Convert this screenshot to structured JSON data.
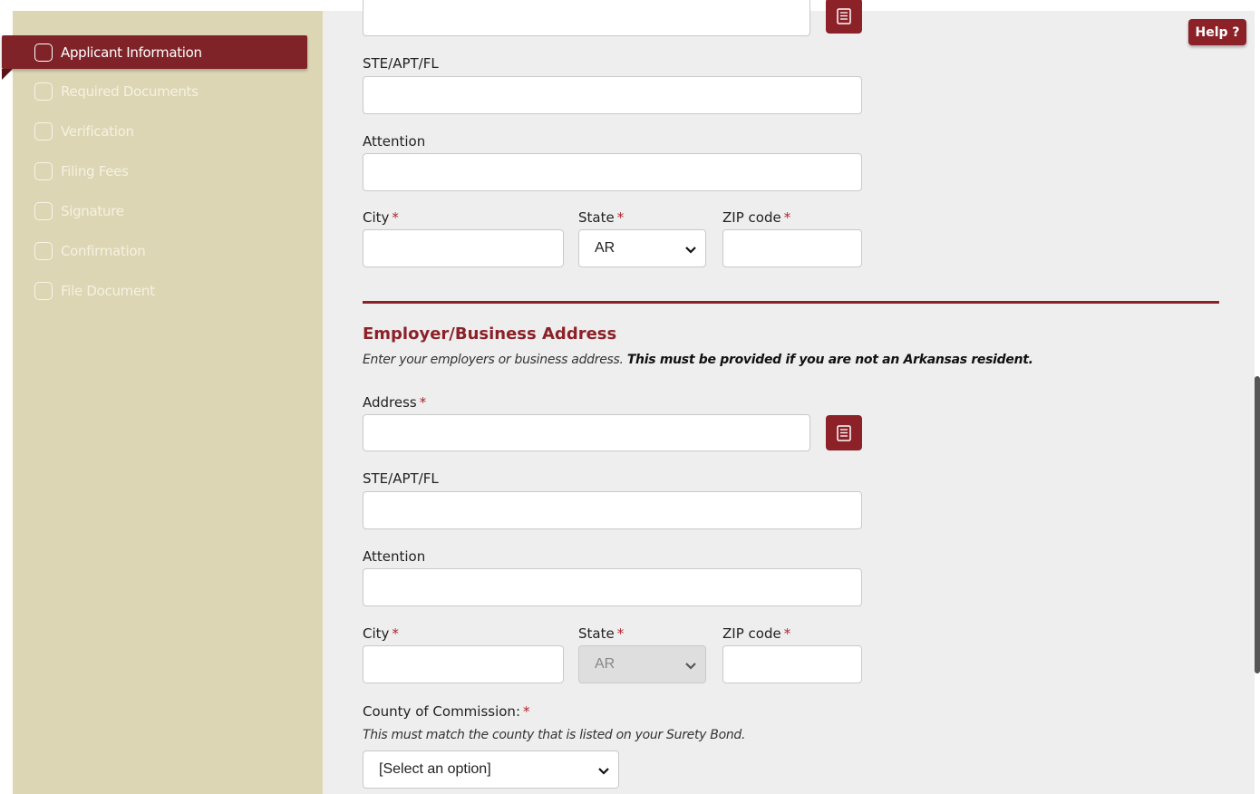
{
  "help_button": "Help ?",
  "steps": [
    {
      "label": "Applicant Information",
      "active": true
    },
    {
      "label": "Required Documents",
      "active": false
    },
    {
      "label": "Verification",
      "active": false
    },
    {
      "label": "Filing Fees",
      "active": false
    },
    {
      "label": "Signature",
      "active": false
    },
    {
      "label": "Confirmation",
      "active": false
    },
    {
      "label": "File Document",
      "active": false
    }
  ],
  "home_address": {
    "suite_label": "STE/APT/FL",
    "attention_label": "Attention",
    "city_label": "City",
    "state_label": "State",
    "state_value": "AR",
    "zip_label": "ZIP code"
  },
  "employer_address": {
    "title": "Employer/Business Address",
    "hint_text": "Enter your employers or business address.",
    "hint_bold": "This must be provided if you are not an Arkansas resident.",
    "address_label": "Address",
    "suite_label": "STE/APT/FL",
    "attention_label": "Attention",
    "city_label": "City",
    "state_label": "State",
    "state_value": "AR",
    "zip_label": "ZIP code"
  },
  "county": {
    "label": "County of Commission:",
    "hint": "This must match the county that is listed on your Surety Bond.",
    "selected": "[Select an option]"
  },
  "required_marker": "*",
  "colors": {
    "accent": "#8c2128",
    "sidebar": "#ddd6b4",
    "page": "#eeeeee"
  }
}
